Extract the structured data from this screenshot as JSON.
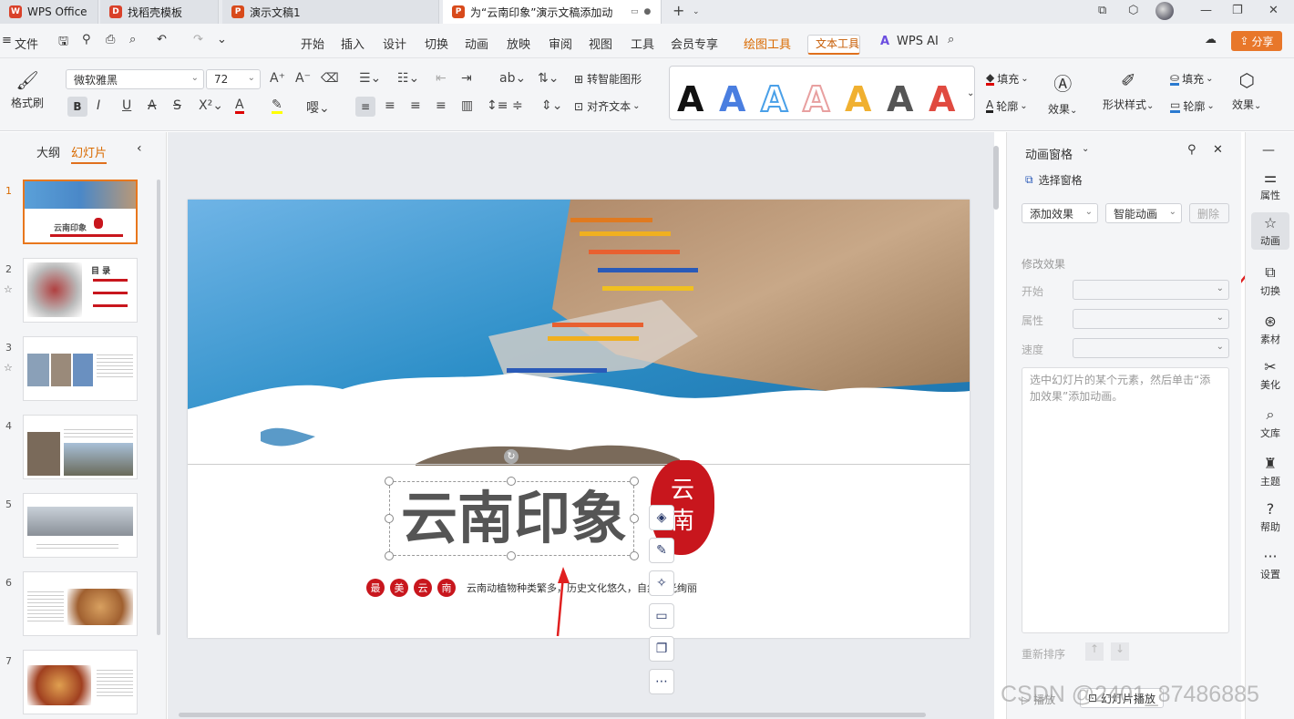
{
  "tabs": [
    {
      "label": "WPS Office"
    },
    {
      "label": "找稻壳模板"
    },
    {
      "label": "演示文稿1"
    },
    {
      "label": "为“云南印象”演示文稿添加动"
    }
  ],
  "menu": {
    "file": "文件",
    "items": [
      "开始",
      "插入",
      "设计",
      "切换",
      "动画",
      "放映",
      "审阅",
      "视图",
      "工具",
      "会员专享"
    ],
    "drawing_tools": "绘图工具",
    "text_tools": "文本工具",
    "wps_ai": "WPS AI",
    "share": "分享"
  },
  "ribbon": {
    "format_painter": "格式刷",
    "font_name": "微软雅黑",
    "font_size": "72",
    "convert_smart": "转智能图形",
    "align_text": "对齐文本",
    "fill": "填充",
    "outline": "轮廓",
    "effect": "效果",
    "shape_style": "形状样式",
    "fill2": "填充",
    "outline2": "轮廓",
    "effect2": "效果"
  },
  "left_panel": {
    "tab_outline": "大纲",
    "tab_slides": "幻灯片",
    "slide_numbers": [
      "1",
      "2",
      "3",
      "4",
      "5",
      "6",
      "7"
    ],
    "thumb1_title": "云南印象",
    "thumb2_title": "目 录"
  },
  "slide": {
    "title": "云南印象",
    "badges": [
      "最",
      "美",
      "云",
      "南"
    ],
    "subtitle": "云南动植物种类繁多，历史文化悠久，自然风光绚丽",
    "stamp_text": "云南"
  },
  "anim_panel": {
    "title": "动画窗格",
    "select_pane": "选择窗格",
    "add_effect": "添加效果",
    "smart_anim": "智能动画",
    "delete": "删除",
    "modify_effect": "修改效果",
    "start_label": "开始",
    "property_label": "属性",
    "speed_label": "速度",
    "hint": "选中幻灯片的某个元素，然后单击“添加效果”添加动画。",
    "reorder": "重新排序",
    "play": "播放",
    "slideshow": "幻灯片播放"
  },
  "sidebar": {
    "items": [
      "属性",
      "动画",
      "切换",
      "素材",
      "美化",
      "文库",
      "主题",
      "帮助",
      "设置"
    ]
  },
  "watermark": "CSDN @2401_87486885",
  "colors": {
    "accent_orange": "#e0701d",
    "red": "#c8161d",
    "arrow_red": "#e02020"
  }
}
